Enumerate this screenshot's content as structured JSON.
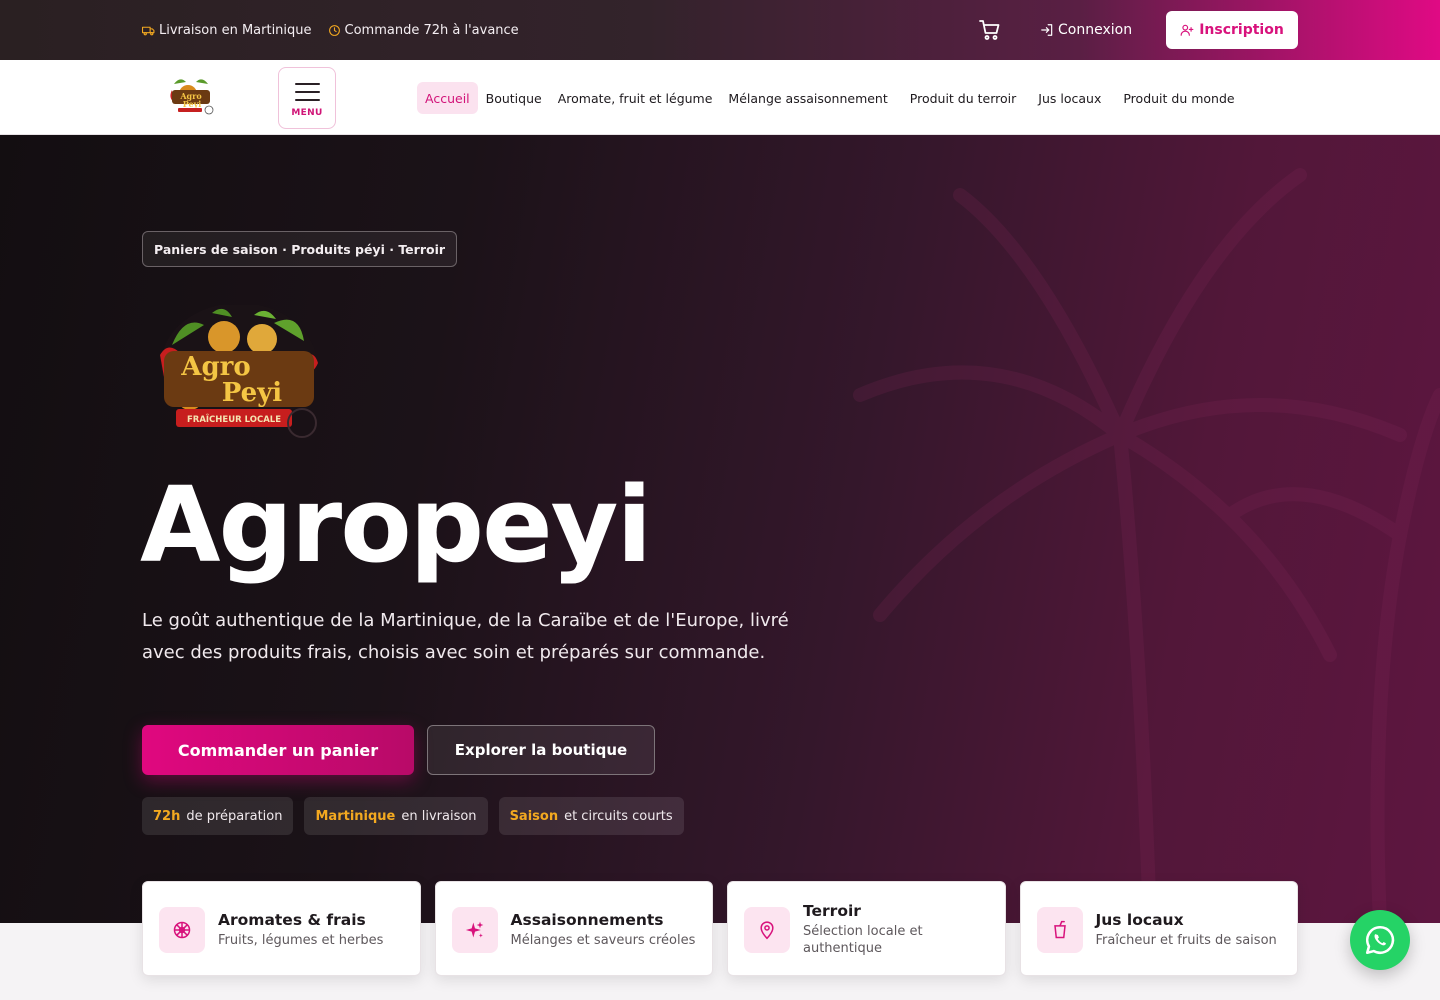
{
  "topbar": {
    "delivery": "Livraison en Martinique",
    "order_advance": "Commande 72h à l'avance",
    "login": "Connexion",
    "signup": "Inscription"
  },
  "nav": {
    "menu_label": "MENU",
    "links": [
      "Accueil",
      "Boutique",
      "Aromate, fruit et légume",
      "Mélange assaisonnement",
      "Produit du terroir",
      "Jus locaux",
      "Produit du monde"
    ],
    "active": "Accueil"
  },
  "hero": {
    "eyebrow": "Paniers de saison · Produits péyi · Terroir",
    "title": "Agropeyi",
    "subtitle": "Le goût authentique de la Martinique, de la Caraïbe et de l'Europe, livré avec des produits frais, choisis avec soin et préparés sur commande.",
    "cta_primary": "Commander un panier",
    "cta_secondary": "Explorer la boutique",
    "stats": [
      {
        "highlight": "72h",
        "text": "de préparation"
      },
      {
        "highlight": "Martinique",
        "text": "en livraison"
      },
      {
        "highlight": "Saison",
        "text": "et circuits courts"
      }
    ]
  },
  "logo": {
    "line1": "Agro",
    "line2": "Peyi",
    "tagline": "FRAÎCHEUR LOCALE"
  },
  "cards": [
    {
      "title": "Aromates & frais",
      "desc": "Fruits, légumes et herbes",
      "icon": "flower-icon"
    },
    {
      "title": "Assaisonnements",
      "desc": "Mélanges et saveurs créoles",
      "icon": "sparkles-icon"
    },
    {
      "title": "Terroir",
      "desc": "Sélection locale et authentique",
      "icon": "map-pin-icon"
    },
    {
      "title": "Jus locaux",
      "desc": "Fraîcheur et fruits de saison",
      "icon": "cup-icon"
    }
  ],
  "colors": {
    "accent": "#e0087f",
    "highlight": "#f3a920",
    "whatsapp": "#25d366"
  }
}
